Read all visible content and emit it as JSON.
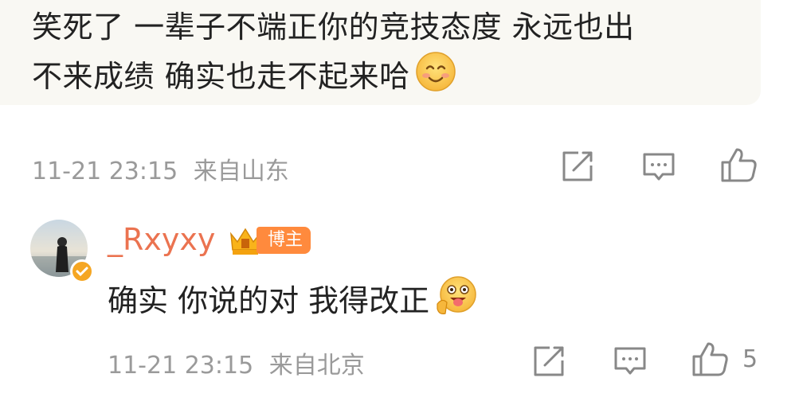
{
  "quoted_comment": {
    "text_line1": "笑死了 一辈子不端正你的竞技态度 永远也出",
    "text_line2": "不来成绩 确实也走不起来哈",
    "emoji": "smile-emoji",
    "timestamp": "11-21 23:15",
    "location": "来自山东"
  },
  "reply": {
    "username": "_Rxyxy",
    "badge_label": "博主",
    "text": "确实 你说的对 我得改正",
    "emoji": "wink-tongue-emoji",
    "timestamp": "11-21 23:15",
    "location": "来自北京",
    "like_count": "5"
  },
  "colors": {
    "username": "#eb7350",
    "badge_bg": "#ff8a3d",
    "meta_text": "#9a9a9a",
    "bubble_bg": "#f9f8f3"
  }
}
